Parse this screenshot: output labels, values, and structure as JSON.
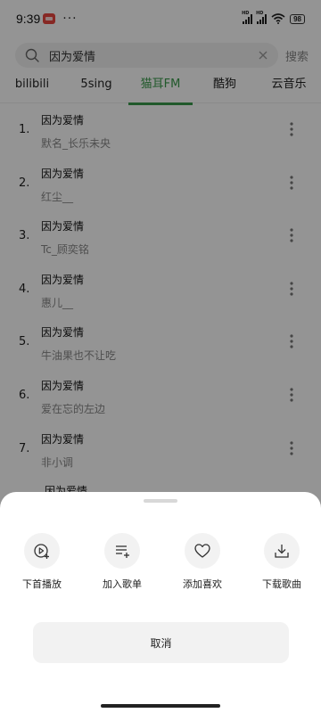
{
  "status_bar": {
    "time": "9:39",
    "notification_icon": "app-notification-icon",
    "more_dots": "···",
    "signal_1_label": "HD",
    "signal_2_label": "HD",
    "battery": "98"
  },
  "search": {
    "query": "因为爱情",
    "button_label": "搜索",
    "icon": "search-icon",
    "clear_icon": "close-icon"
  },
  "tabs": [
    {
      "label": "bilibili",
      "active": false
    },
    {
      "label": "5sing",
      "active": false
    },
    {
      "label": "猫耳FM",
      "active": true
    },
    {
      "label": "酷狗",
      "active": false
    },
    {
      "label": "云音乐",
      "active": false
    }
  ],
  "accent_color": "#3a9a4a",
  "results": [
    {
      "num": "1.",
      "title": "因为爱情",
      "artist": "默名_长乐未央"
    },
    {
      "num": "2.",
      "title": "因为爱情",
      "artist": "红尘__"
    },
    {
      "num": "3.",
      "title": "因为爱情",
      "artist": "Tc_顾奕铭"
    },
    {
      "num": "4.",
      "title": "因为爱情",
      "artist": "惠儿__"
    },
    {
      "num": "5.",
      "title": "因为爱情",
      "artist": "牛油果也不让吃"
    },
    {
      "num": "6.",
      "title": "因为爱情",
      "artist": "爱在忘的左边"
    },
    {
      "num": "7.",
      "title": "因为爱情",
      "artist": "非小调"
    }
  ],
  "partial_row_title": "因为爱情",
  "sheet": {
    "actions": [
      {
        "label": "下首播放",
        "icon": "play-next-icon"
      },
      {
        "label": "加入歌单",
        "icon": "add-to-playlist-icon"
      },
      {
        "label": "添加喜欢",
        "icon": "heart-icon"
      },
      {
        "label": "下载歌曲",
        "icon": "download-icon"
      }
    ],
    "cancel_label": "取消"
  }
}
